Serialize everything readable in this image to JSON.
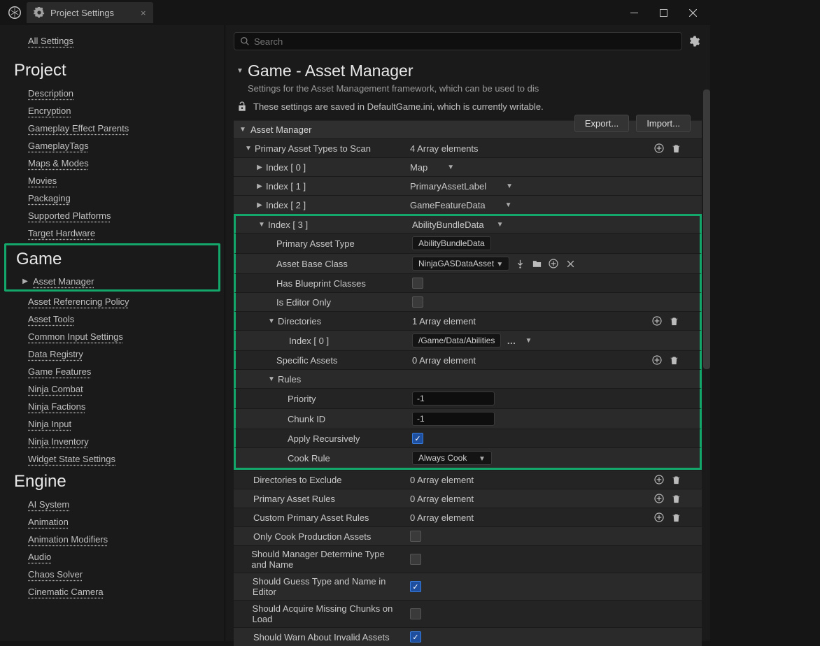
{
  "window": {
    "title": "Project Settings"
  },
  "sidebar": {
    "all": "All Settings",
    "categories": [
      {
        "name": "Project",
        "items": [
          "Description",
          "Encryption",
          "Gameplay Effect Parents",
          "GameplayTags",
          "Maps & Modes",
          "Movies",
          "Packaging",
          "Supported Platforms",
          "Target Hardware"
        ]
      },
      {
        "name": "Game",
        "highlight": true,
        "items": [
          "Asset Manager",
          "Asset Referencing Policy",
          "Asset Tools",
          "Common Input Settings",
          "Data Registry",
          "Game Features",
          "Ninja Combat",
          "Ninja Factions",
          "Ninja Input",
          "Ninja Inventory",
          "Widget State Settings"
        ],
        "selectedIndex": 0
      },
      {
        "name": "Engine",
        "items": [
          "AI System",
          "Animation",
          "Animation Modifiers",
          "Audio",
          "Chaos Solver",
          "Cinematic Camera"
        ]
      }
    ]
  },
  "search": {
    "placeholder": "Search"
  },
  "section": {
    "title": "Game - Asset Manager",
    "desc": "Settings for the Asset Management framework, which can be used to dis",
    "buttons": {
      "export": "Export...",
      "import": "Import..."
    },
    "ini": "These settings are saved in DefaultGame.ini, which is currently writable."
  },
  "props": {
    "groupHeader": "Asset Manager",
    "primaryArrayLabel": "Primary Asset Types to Scan",
    "primaryArrayCount": "4 Array elements",
    "indexRows": [
      {
        "label": "Index [ 0 ]",
        "value": "Map"
      },
      {
        "label": "Index [ 1 ]",
        "value": "PrimaryAssetLabel"
      },
      {
        "label": "Index [ 2 ]",
        "value": "GameFeatureData"
      }
    ],
    "index3": {
      "label": "Index [ 3 ]",
      "value": "AbilityBundleData",
      "primaryAssetTypeLabel": "Primary Asset Type",
      "primaryAssetTypeValue": "AbilityBundleData",
      "baseClassLabel": "Asset Base Class",
      "baseClassValue": "NinjaGASDataAsset",
      "hasBlueprintLabel": "Has Blueprint Classes",
      "hasBlueprintValue": false,
      "isEditorOnlyLabel": "Is Editor Only",
      "isEditorOnlyValue": false,
      "directoriesLabel": "Directories",
      "directoriesCount": "1 Array element",
      "dirIndexLabel": "Index [ 0 ]",
      "dirIndexValue": "/Game/Data/Abilities",
      "specificAssetsLabel": "Specific Assets",
      "specificAssetsCount": "0 Array element",
      "rulesLabel": "Rules",
      "priorityLabel": "Priority",
      "priorityValue": "-1",
      "chunkLabel": "Chunk ID",
      "chunkValue": "-1",
      "applyRecLabel": "Apply Recursively",
      "applyRecValue": true,
      "cookRuleLabel": "Cook Rule",
      "cookRuleValue": "Always Cook"
    },
    "bottom": [
      {
        "label": "Directories to Exclude",
        "value": "0 Array element",
        "type": "array"
      },
      {
        "label": "Primary Asset Rules",
        "value": "0 Array element",
        "type": "array"
      },
      {
        "label": "Custom Primary Asset Rules",
        "value": "0 Array element",
        "type": "array"
      },
      {
        "label": "Only Cook Production Assets",
        "type": "check",
        "checked": false
      },
      {
        "label": "Should Manager Determine Type and Name",
        "type": "check",
        "checked": false
      },
      {
        "label": "Should Guess Type and Name in Editor",
        "type": "check",
        "checked": true
      },
      {
        "label": "Should Acquire Missing Chunks on Load",
        "type": "check",
        "checked": false
      },
      {
        "label": "Should Warn About Invalid Assets",
        "type": "check",
        "checked": true
      }
    ]
  }
}
